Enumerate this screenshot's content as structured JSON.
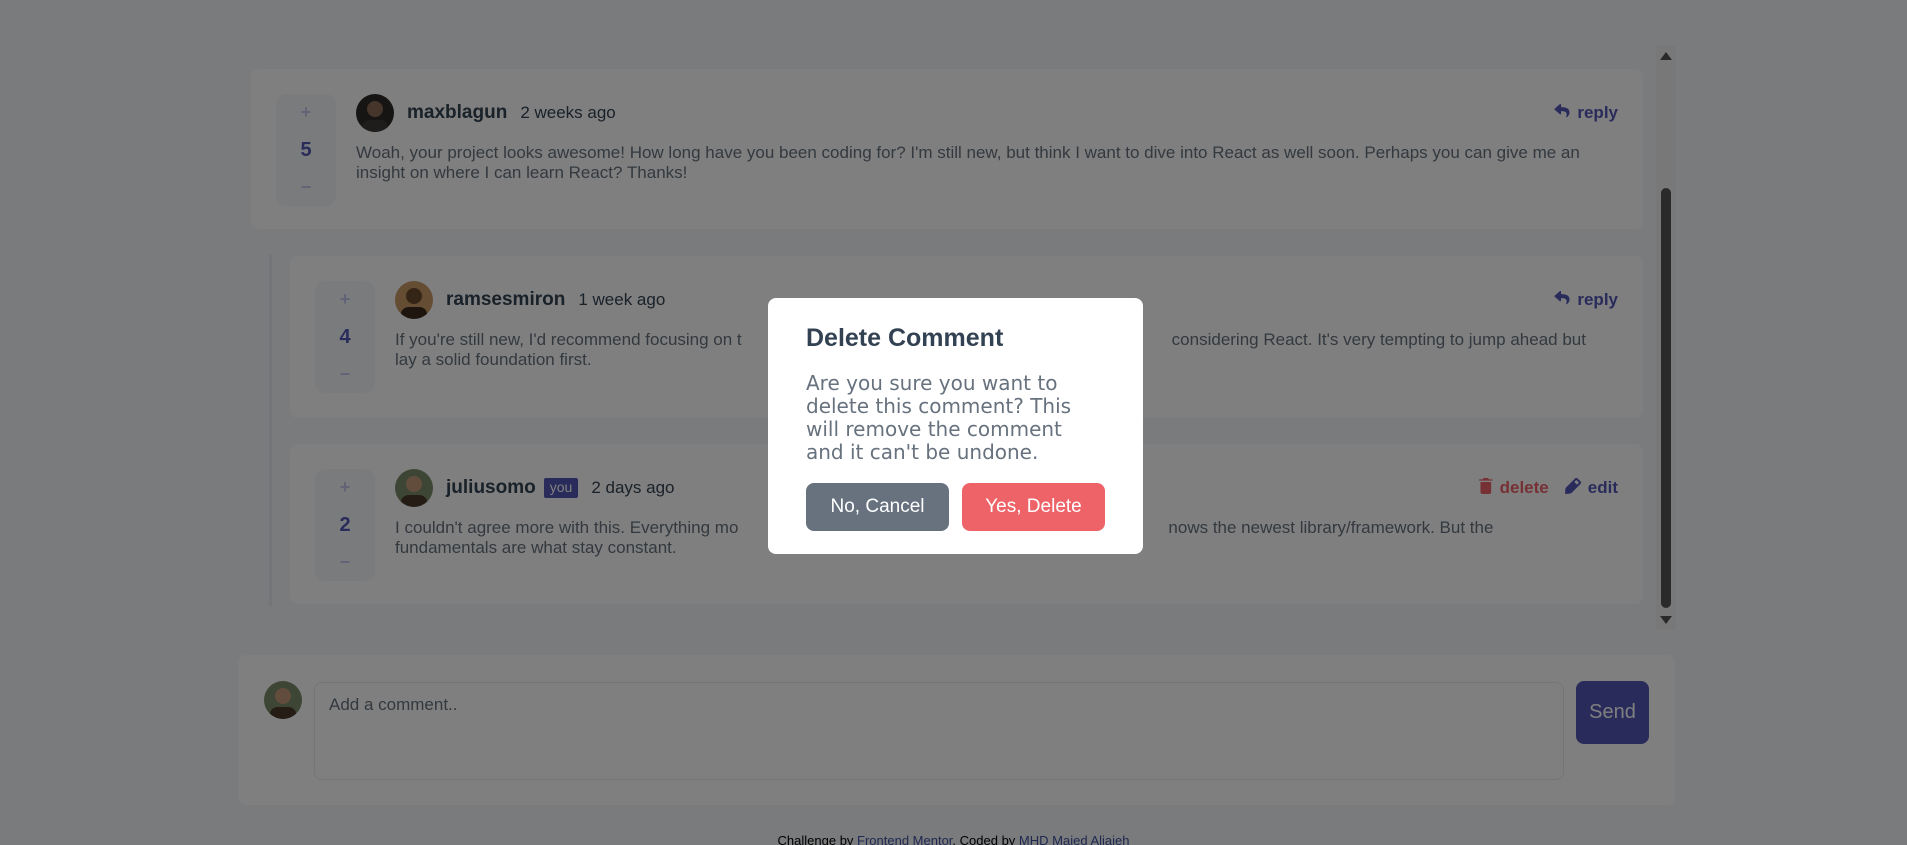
{
  "comments": [
    {
      "score": "5",
      "username": "maxblagun",
      "time": "2 weeks ago",
      "action": "reply",
      "content": "Woah, your project looks awesome! How long have you been coding for? I'm still new, but think I want to dive into React as well soon. Perhaps you can give me an insight on where I can learn React? Thanks!"
    },
    {
      "score": "4",
      "username": "ramsesmiron",
      "time": "1 week ago",
      "action": "reply",
      "content_left": "If you're still new, I'd recommend focusing on t",
      "content_right": "considering React. It's very tempting to jump ahead but",
      "content_line2": "lay a solid foundation first."
    },
    {
      "score": "2",
      "username": "juliusomo",
      "you": "you",
      "time": "2 days ago",
      "delete_label": "delete",
      "edit_label": "edit",
      "content_left": "I couldn't agree more with this. Everything mo",
      "content_right": "nows the newest library/framework. But the",
      "content_line2": "fundamentals are what stay constant."
    }
  ],
  "vote": {
    "plus": "+",
    "minus": "−"
  },
  "add_comment": {
    "placeholder": "Add a comment..",
    "send_label": "Send"
  },
  "footer": {
    "prefix": "Challenge by ",
    "link1": "Frontend Mentor",
    "middle": ". Coded by ",
    "link2": "MHD Majed Aljajeh"
  },
  "modal": {
    "title": "Delete Comment",
    "body": "Are you sure you want to delete this comment? This will remove the comment and it can't be undone.",
    "cancel_label": "No, Cancel",
    "confirm_label": "Yes, Delete"
  },
  "colors": {
    "primary": "#5357b6",
    "danger": "#ed6368",
    "neutral": "#67727e",
    "dark": "#334253",
    "overlay": "rgba(0,0,0,0.5)"
  }
}
